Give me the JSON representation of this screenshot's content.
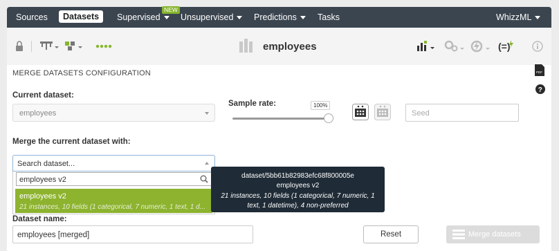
{
  "nav": {
    "items": [
      {
        "label": "Sources",
        "active": false,
        "caret": false
      },
      {
        "label": "Datasets",
        "active": true,
        "caret": false
      },
      {
        "label": "Supervised",
        "active": false,
        "caret": true
      },
      {
        "label": "Unsupervised",
        "active": false,
        "caret": true
      },
      {
        "label": "Predictions",
        "active": false,
        "caret": true
      },
      {
        "label": "Tasks",
        "active": false,
        "caret": false
      }
    ],
    "new_badge": "NEW",
    "user": "WhizzML"
  },
  "toolbar": {
    "title": "employees",
    "left_icons": [
      "lock-icon",
      "tree-network-icon",
      "model-config-icon",
      "dots-icon"
    ],
    "right_icons": [
      "scatterplot-icon",
      "gears-icon",
      "bolt-icon",
      "formula-icon",
      "info-icon"
    ]
  },
  "panel": {
    "section_title": "MERGE DATASETS CONFIGURATION",
    "current_dataset_label": "Current dataset:",
    "current_dataset_value": "employees",
    "sample_rate_label": "Sample rate:",
    "sample_rate_value": "100%",
    "sample_rate_fraction": 1.0,
    "seed_placeholder": "Seed",
    "merge_with_label": "Merge the current dataset with:",
    "search_dataset_label": "Search dataset...",
    "search_query": "employees v2",
    "result": {
      "name": "employees v2",
      "details": "21 instances, 10 fields (1 categorical, 7 numeric, 1 text, 1 d..."
    },
    "tooltip": {
      "line1": "dataset/5bb61b82983efc68f800005e",
      "line2": "employees v2",
      "line3": "21 instances, 10 fields (1 categorical, 7 numeric, 1",
      "line4": "text, 1 datetime), 4 non-preferred"
    },
    "dataset_name_label": "Dataset name:",
    "dataset_name_value": "employees [merged]",
    "reset_label": "Reset",
    "merge_label": "Merge datasets"
  },
  "colors": {
    "nav_bg": "#3b454f",
    "accent_green": "#8db32f",
    "tooltip_bg": "#1f2b36"
  }
}
